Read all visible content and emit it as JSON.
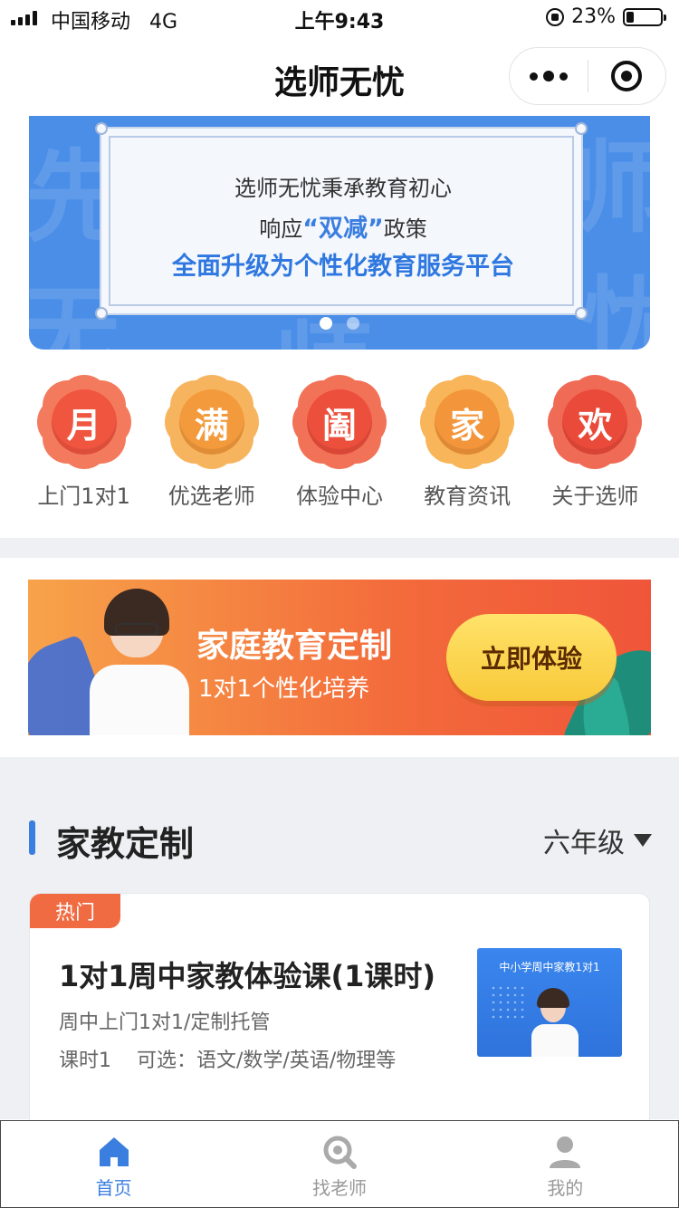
{
  "status_bar": {
    "carrier": "中国移动",
    "network": "4G",
    "time": "上午9:43",
    "battery": "23%",
    "battery_level": 0.23
  },
  "nav": {
    "title": "选师无忧"
  },
  "banner": {
    "line1": "选师无忧秉承教育初心",
    "line2_prefix": "响应",
    "line2_highlight": "“双减”",
    "line2_suffix": "政策",
    "line3": "全面升级为个性化教育服务平台",
    "bg_chars": [
      "先",
      "无",
      "师",
      "忧",
      "师"
    ],
    "active_slide": 1,
    "slide_count": 2
  },
  "grid": {
    "items": [
      {
        "glyph": "月",
        "label": "上门1对1",
        "color": "#f0553f",
        "petal": "#f37a5c"
      },
      {
        "glyph": "满",
        "label": "优选老师",
        "color": "#f39a3c",
        "petal": "#f7b45e"
      },
      {
        "glyph": "阖",
        "label": "体验中心",
        "color": "#ec4f3b",
        "petal": "#f27257"
      },
      {
        "glyph": "家",
        "label": "教育资讯",
        "color": "#f3953a",
        "petal": "#f8b559"
      },
      {
        "glyph": "欢",
        "label": "关于选师",
        "color": "#ea4a3a",
        "petal": "#f06b56"
      }
    ]
  },
  "promo": {
    "title": "家庭教育定制",
    "subtitle": "1对1个性化培养",
    "cta": "立即体验"
  },
  "section": {
    "title": "家教定制",
    "grade": "六年级"
  },
  "course": {
    "tag": "热门",
    "title": "1对1周中家教体验课(1课时)",
    "subtitle": "周中上门1对1/定制托管",
    "hours": "课时1",
    "options": "可选：语文/数学/英语/物理等",
    "thumb_text": "中小学周中家教1对1"
  },
  "tabbar": {
    "tabs": [
      {
        "label": "首页",
        "icon": "home-icon",
        "active": true
      },
      {
        "label": "找老师",
        "icon": "search-icon",
        "active": false
      },
      {
        "label": "我的",
        "icon": "user-icon",
        "active": false
      }
    ]
  },
  "colors": {
    "accent": "#3a7ee0",
    "hot": "#f06a42",
    "cta": "#f8c93a"
  }
}
